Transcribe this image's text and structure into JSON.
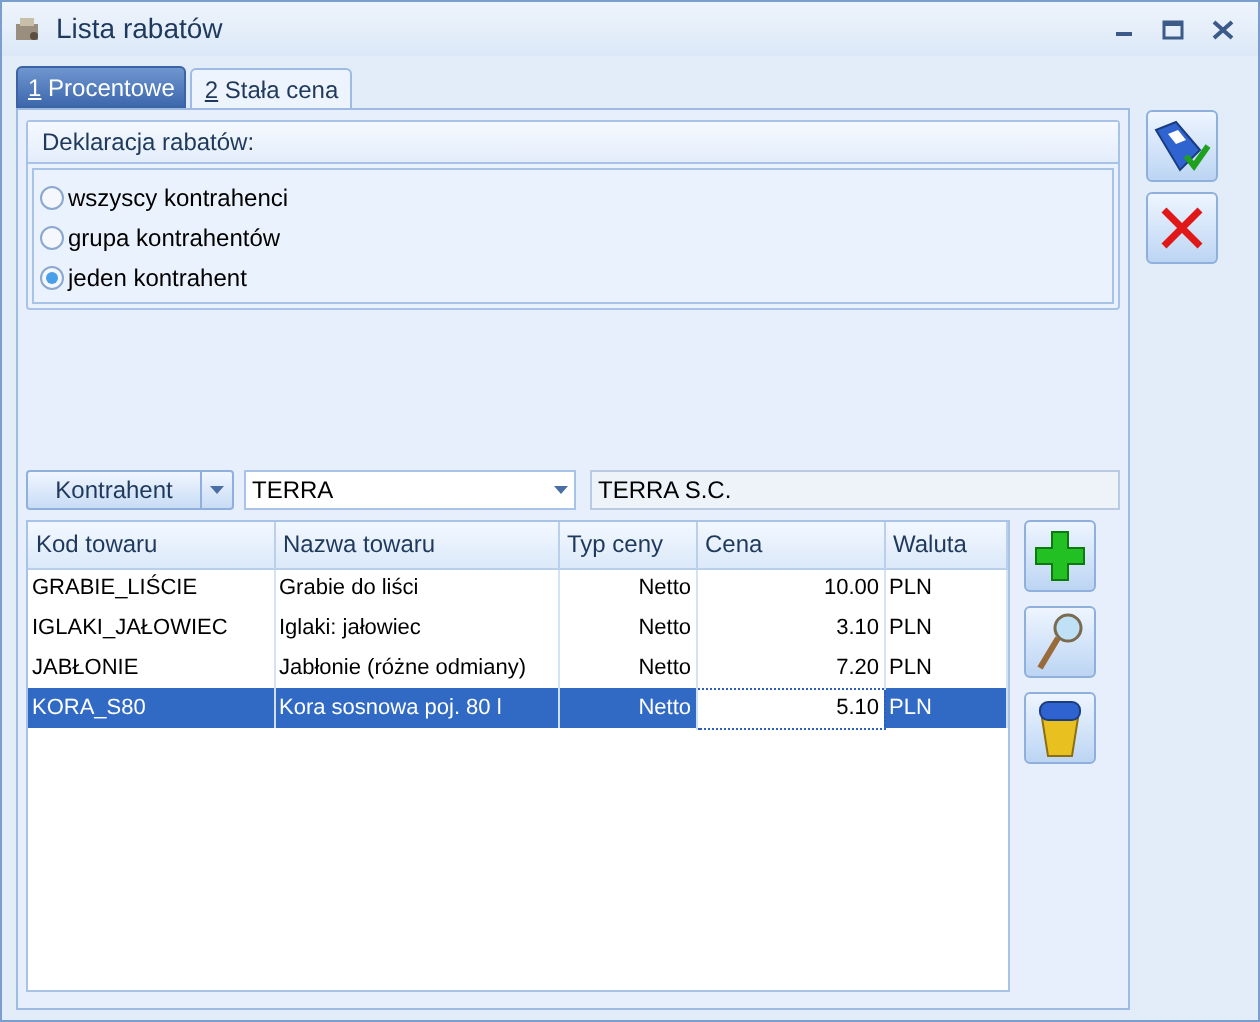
{
  "window": {
    "title": "Lista rabatów"
  },
  "tabs": [
    {
      "key": "1",
      "label": "Procentowe",
      "selected": true
    },
    {
      "key": "2",
      "label": "Stała cena",
      "selected": false
    }
  ],
  "group": {
    "title": "Deklaracja rabatów:",
    "options": [
      {
        "label": "wszyscy kontrahenci",
        "selected": false
      },
      {
        "label": "grupa kontrahentów",
        "selected": false
      },
      {
        "label": "jeden kontrahent",
        "selected": true
      }
    ]
  },
  "filter": {
    "button": "Kontrahent",
    "combo_value": "TERRA",
    "name_value": "TERRA S.C."
  },
  "table": {
    "columns": [
      "Kod towaru",
      "Nazwa towaru",
      "Typ ceny",
      "Cena",
      "Waluta"
    ],
    "rows": [
      {
        "cells": [
          "GRABIE_LIŚCIE",
          "Grabie do liści",
          "Netto",
          "10.00",
          "PLN"
        ],
        "selected": false
      },
      {
        "cells": [
          "IGLAKI_JAŁOWIEC",
          "Iglaki: jałowiec",
          "Netto",
          "3.10",
          "PLN"
        ],
        "selected": false
      },
      {
        "cells": [
          "JABŁONIE",
          "Jabłonie (różne odmiany)",
          "Netto",
          "7.20",
          "PLN"
        ],
        "selected": false
      },
      {
        "cells": [
          "KORA_S80",
          "Kora sosnowa poj. 80 l",
          "Netto",
          "5.10",
          "PLN"
        ],
        "selected": true
      }
    ]
  }
}
